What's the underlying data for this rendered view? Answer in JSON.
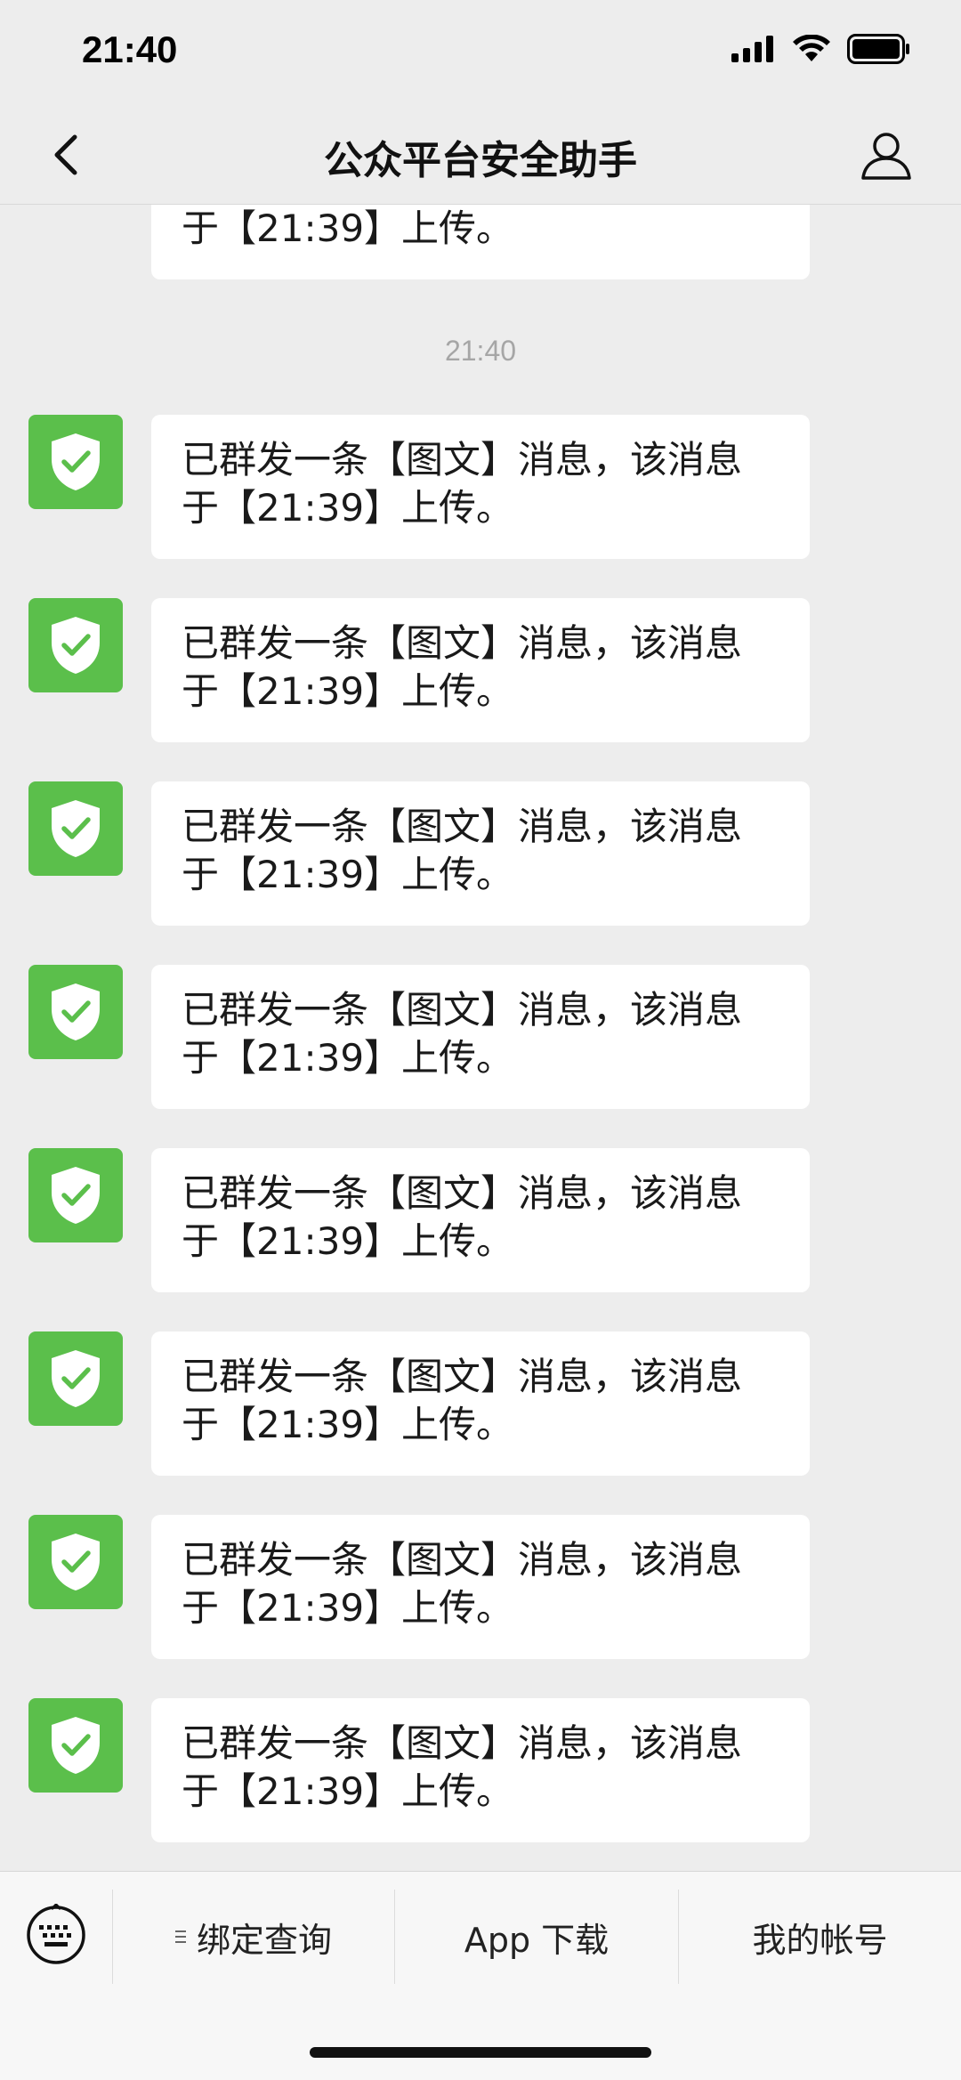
{
  "status_bar": {
    "time": "21:40"
  },
  "header": {
    "title": "公众平台安全助手"
  },
  "chat": {
    "timestamp": "21:40",
    "partial_message_text": "于【21:39】上传。",
    "messages": [
      {
        "line1": "已群发一条【图文】消息，该消息",
        "line2": "于【21:39】上传。"
      },
      {
        "line1": "已群发一条【图文】消息，该消息",
        "line2": "于【21:39】上传。"
      },
      {
        "line1": "已群发一条【图文】消息，该消息",
        "line2": "于【21:39】上传。"
      },
      {
        "line1": "已群发一条【图文】消息，该消息",
        "line2": "于【21:39】上传。"
      },
      {
        "line1": "已群发一条【图文】消息，该消息",
        "line2": "于【21:39】上传。"
      },
      {
        "line1": "已群发一条【图文】消息，该消息",
        "line2": "于【21:39】上传。"
      },
      {
        "line1": "已群发一条【图文】消息，该消息",
        "line2": "于【21:39】上传。"
      },
      {
        "line1": "已群发一条【图文】消息，该消息",
        "line2": "于【21:39】上传。"
      }
    ]
  },
  "bottom_menu": {
    "items": [
      {
        "label": "绑定查询"
      },
      {
        "label": "App 下载"
      },
      {
        "label": "我的帐号"
      }
    ]
  },
  "icons": {
    "back": "chevron-left-icon",
    "profile": "person-icon",
    "avatar": "shield-check-icon",
    "keyboard": "keyboard-icon",
    "menu_lines": "menu-lines-icon"
  },
  "colors": {
    "background": "#ededed",
    "bubble": "#ffffff",
    "avatar": "#5bbf4b",
    "timestamp": "#a6a6a6"
  }
}
